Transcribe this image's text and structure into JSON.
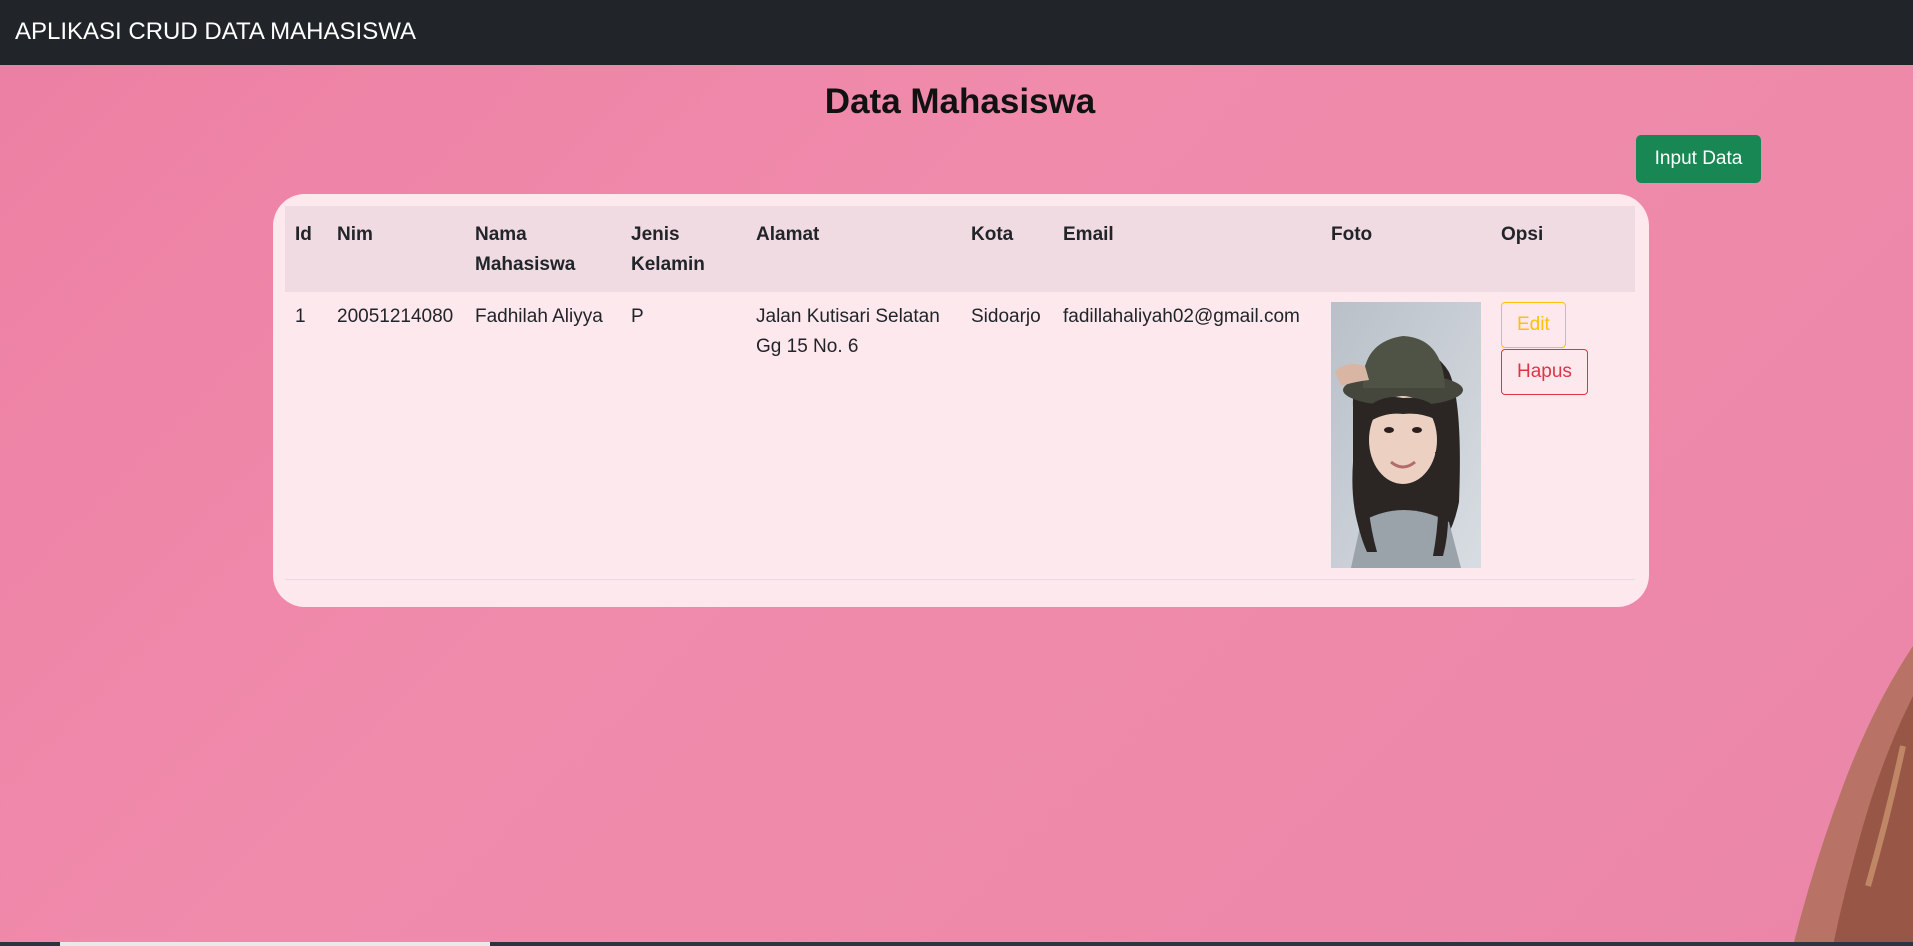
{
  "navbar": {
    "title": "APLIKASI CRUD DATA MAHASISWA"
  },
  "page": {
    "title": "Data Mahasiswa",
    "input_button": "Input Data"
  },
  "table": {
    "headers": {
      "id": "Id",
      "nim": "Nim",
      "nama": "Nama Mahasiswa",
      "jenis_kelamin": "Jenis Kelamin",
      "alamat": "Alamat",
      "kota": "Kota",
      "email": "Email",
      "foto": "Foto",
      "opsi": "Opsi"
    },
    "rows": [
      {
        "id": "1",
        "nim": "20051214080",
        "nama": "Fadhilah Aliyya",
        "jenis_kelamin": "P",
        "alamat": "Jalan Kutisari Selatan Gg 15 No. 6",
        "kota": "Sidoarjo",
        "email": "fadillahaliyah02@gmail.com",
        "edit_label": "Edit",
        "hapus_label": "Hapus"
      }
    ]
  },
  "colors": {
    "navbar_bg": "#212529",
    "page_bg": "#ee89aa",
    "card_bg": "#fde8ee",
    "primary_button": "#198754",
    "edit_button": "#ffc107",
    "hapus_button": "#dc3545"
  }
}
